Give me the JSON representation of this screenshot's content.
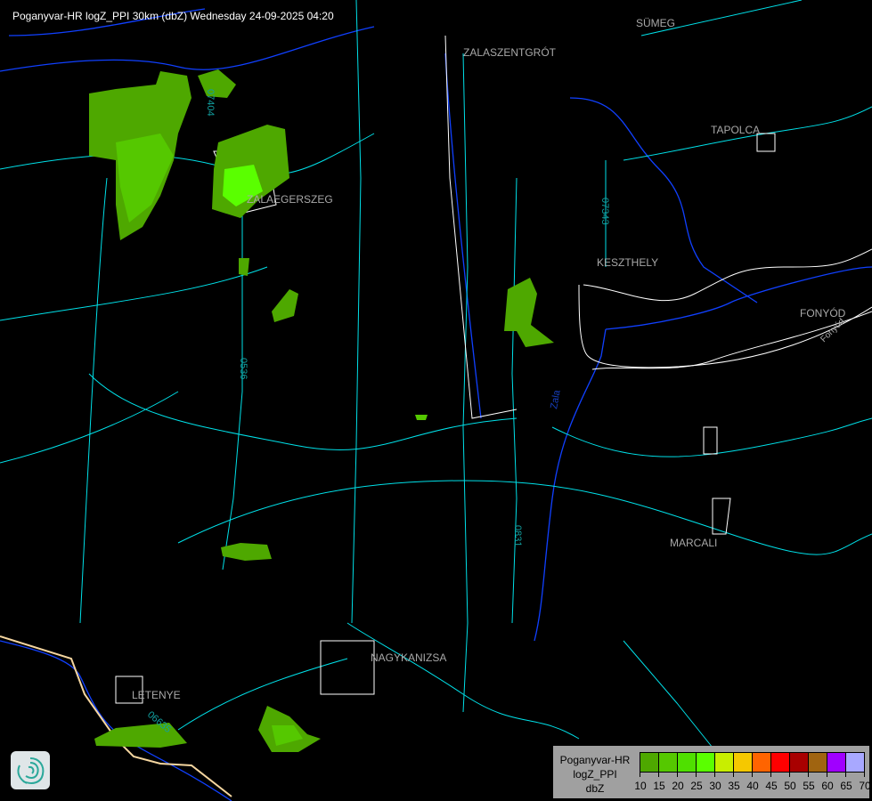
{
  "title": "Poganyvar-HR logZ_PPI 30km (dbZ) Wednesday 24-09-2025 04:20",
  "cities": [
    "SÜMEG",
    "ZALASZENTGRÓT",
    "TAPOLCA",
    "ZALAEGERSZEG",
    "KESZTHELY",
    "FONYÓD",
    "MARCALI",
    "NAGYKANIZSA",
    "LETENYE"
  ],
  "road_labels": [
    "07343",
    "0536",
    "0831",
    "06635",
    "07404"
  ],
  "river_labels": [
    "Zala",
    "Fonyód"
  ],
  "legend": {
    "line1": "Poganyvar-HR",
    "line2": "logZ_PPI",
    "line3": "dbZ",
    "ticks": [
      "10",
      "15",
      "20",
      "25",
      "30",
      "35",
      "40",
      "45",
      "50",
      "55",
      "60",
      "65",
      "70"
    ],
    "colors": [
      "#4ea800",
      "#55c800",
      "#4fe000",
      "#5aff00",
      "#c8ee00",
      "#f5c800",
      "#ff6400",
      "#ff0000",
      "#a80000",
      "#a06410",
      "#a000ff",
      "#a8a8ff"
    ]
  },
  "colors": {
    "roads": "#00e0e8",
    "rivers": "#1040ff",
    "boundaries": "#ffffff",
    "border": "#f5d6a0"
  },
  "icons": {
    "logo": "radar-swirl-logo"
  }
}
